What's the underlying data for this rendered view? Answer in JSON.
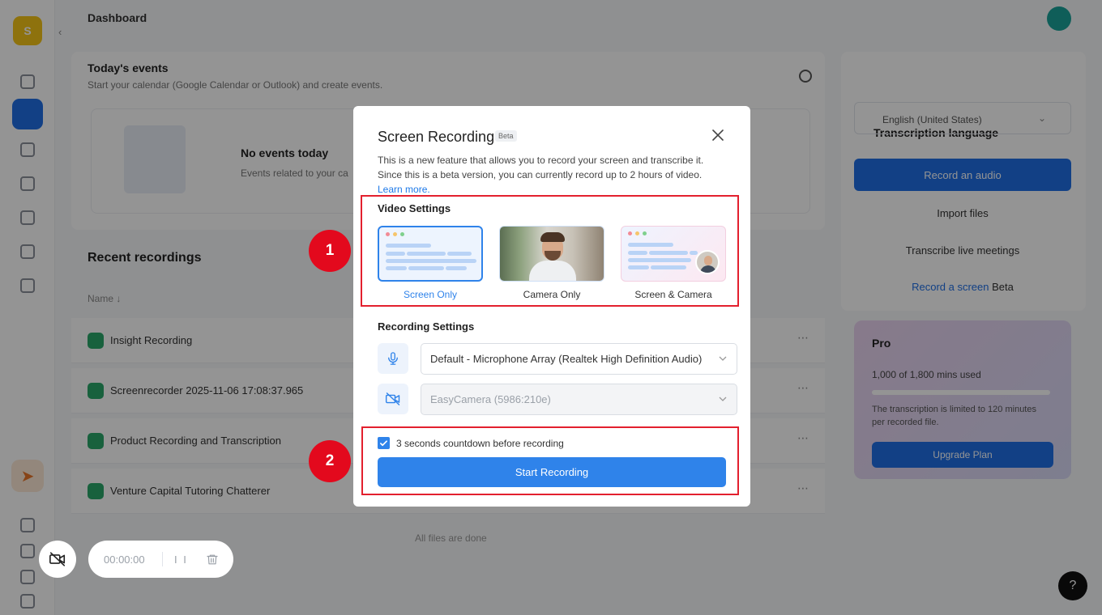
{
  "app": {
    "logo_glyph": "S",
    "page_title": "Dashboard",
    "events": {
      "title": "Today's events",
      "subtitle": "Start your calendar (Google Calendar or Outlook) and create events.",
      "empty_title": "No events today",
      "empty_subtitle": "Events related to your ca"
    },
    "recent_title": "Recent recordings",
    "table_header": "Name ↓",
    "recordings": [
      "Insight Recording",
      "Screenrecorder 2025-11-06 17:08:37.965",
      "Product Recording and Transcription",
      "Venture Capital Tutoring Chatterer"
    ],
    "end_of_list": "All files are done",
    "right_panel": {
      "lang_title": "Transcription language",
      "lang_value": "English (United States)",
      "record_audio": "Record an audio",
      "import_files": "Import files",
      "transcribe_meetings": "Transcribe live meetings",
      "record_screen": "Record a screen",
      "record_screen_badge": "Beta"
    },
    "plan": {
      "title": "Pro",
      "minutes": "1,000 of 1,800 mins used",
      "note": "The transcription is limited to 120 minutes per recorded file.",
      "upgrade": "Upgrade Plan"
    },
    "help_glyph": "?"
  },
  "recorder": {
    "time": "00:00:00",
    "pause_glyph": "I I"
  },
  "modal": {
    "title": "Screen Recording",
    "badge": "Beta",
    "description": "This is a new feature that allows you to record your screen and transcribe it. Since this is a beta version, you can currently record up to 2 hours of video.",
    "learn_more": "Learn more.",
    "video_settings_label": "Video Settings",
    "options": [
      {
        "label": "Screen Only",
        "selected": true
      },
      {
        "label": "Camera Only",
        "selected": false
      },
      {
        "label": "Screen & Camera",
        "selected": false
      }
    ],
    "recording_settings_label": "Recording Settings",
    "microphone": "Default - Microphone Array (Realtek High Definition Audio)",
    "camera": "EasyCamera (5986:210e)",
    "countdown_label": "3 seconds countdown before recording",
    "countdown_checked": true,
    "start_button": "Start Recording"
  },
  "annotations": [
    "1",
    "2"
  ],
  "colors": {
    "accent": "#2f83ea",
    "annotation_red": "#e3091d",
    "overlay": "rgba(0,0,0,0.42)"
  },
  "icons": {
    "close": "close-icon",
    "microphone": "microphone-icon",
    "camera_off": "camera-off-icon",
    "chevron": "chevron-down-icon",
    "check": "check-icon",
    "trash": "trash-icon"
  }
}
